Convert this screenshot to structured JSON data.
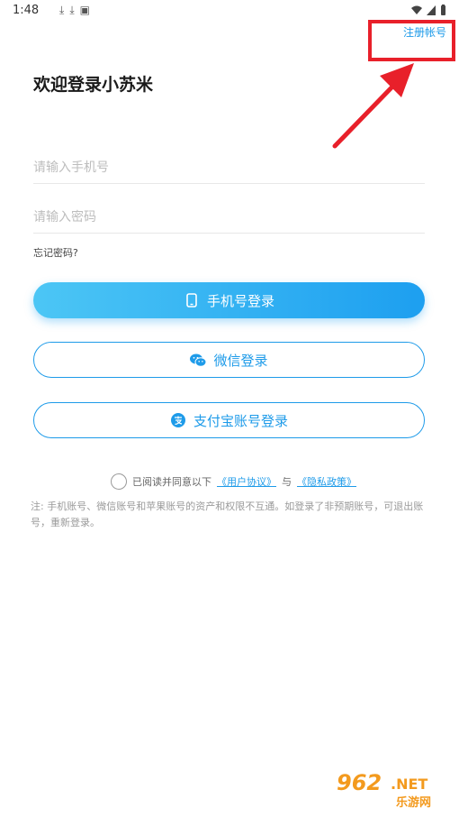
{
  "status_bar": {
    "time": "1:48"
  },
  "header": {
    "register_label": "注册帐号"
  },
  "title": "欢迎登录小苏米",
  "form": {
    "phone_placeholder": "请输入手机号",
    "password_placeholder": "请输入密码",
    "forgot_label": "忘记密码?"
  },
  "buttons": {
    "phone_login": "手机号登录",
    "wechat_login": "微信登录",
    "alipay_login": "支付宝账号登录"
  },
  "agreement": {
    "prefix": "已阅读并同意以下",
    "user_agreement": "《用户协议》",
    "connector": "与",
    "privacy_policy": "《隐私政策》"
  },
  "note": "注: 手机账号、微信账号和苹果账号的资产和权限不互通。如登录了非预期账号，可退出账号，重新登录。",
  "watermark": {
    "number": "962",
    "domain": ".NET",
    "subtitle": "乐游网"
  },
  "colors": {
    "accent": "#1e9be9",
    "highlight": "#e8202a",
    "watermark": "#f39a1e"
  }
}
